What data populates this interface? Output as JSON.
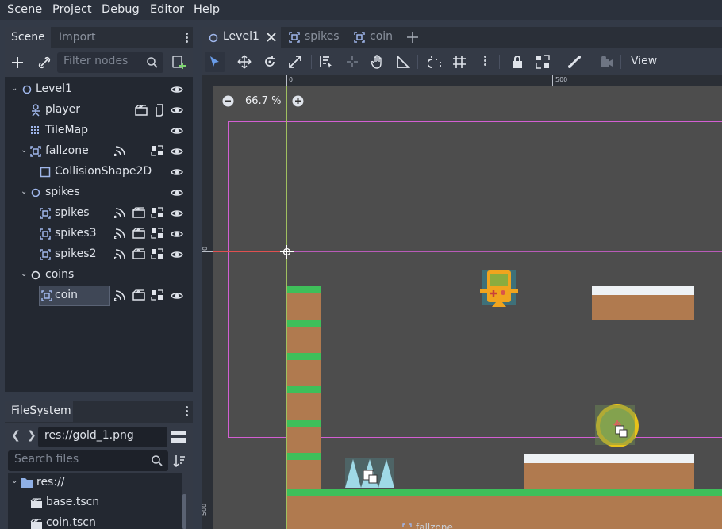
{
  "menu": [
    "Scene",
    "Project",
    "Debug",
    "Editor",
    "Help"
  ],
  "scene_dock": {
    "tabs": [
      "Scene",
      "Import"
    ],
    "filter_placeholder": "Filter nodes",
    "tree": [
      {
        "label": "Level1",
        "icon": "node2d-icon",
        "indent": 0,
        "arrow": true
      },
      {
        "label": "player",
        "icon": "kinematic-body-icon",
        "indent": 1,
        "arrow": false
      },
      {
        "label": "TileMap",
        "icon": "tilemap-icon",
        "indent": 1,
        "arrow": false
      },
      {
        "label": "fallzone",
        "icon": "area2d-icon",
        "indent": 1,
        "arrow": true
      },
      {
        "label": "CollisionShape2D",
        "icon": "collision-shape-icon",
        "indent": 2,
        "arrow": false
      },
      {
        "label": "spikes",
        "icon": "node2d-icon",
        "indent": 1,
        "arrow": true
      },
      {
        "label": "spikes",
        "icon": "area2d-icon",
        "indent": 2,
        "arrow": false
      },
      {
        "label": "spikes3",
        "icon": "area2d-icon",
        "indent": 2,
        "arrow": false
      },
      {
        "label": "spikes2",
        "icon": "area2d-icon",
        "indent": 2,
        "arrow": false
      },
      {
        "label": "coins",
        "icon": "node2d-icon",
        "indent": 1,
        "arrow": true
      },
      {
        "label": "coin",
        "icon": "area2d-icon",
        "indent": 2,
        "arrow": false,
        "selected": true
      }
    ]
  },
  "filesystem": {
    "title": "FileSystem",
    "path": "res://gold_1.png",
    "search_placeholder": "Search files",
    "items": [
      {
        "label": "res://",
        "type": "folder"
      },
      {
        "label": "base.tscn",
        "type": "scene"
      },
      {
        "label": "coin.tscn",
        "type": "scene"
      }
    ]
  },
  "editor": {
    "tabs": [
      "Level1",
      "spikes",
      "coin"
    ],
    "view_label": "View",
    "zoom": "66.7 %",
    "ruler_marks": [
      "0",
      "500"
    ],
    "bottom_label": "fallzone"
  },
  "colors": {
    "accent": "#699ce8",
    "selection_rect": "#d35fd3",
    "axis_x": "#e05050",
    "axis_y": "#a0c060"
  }
}
